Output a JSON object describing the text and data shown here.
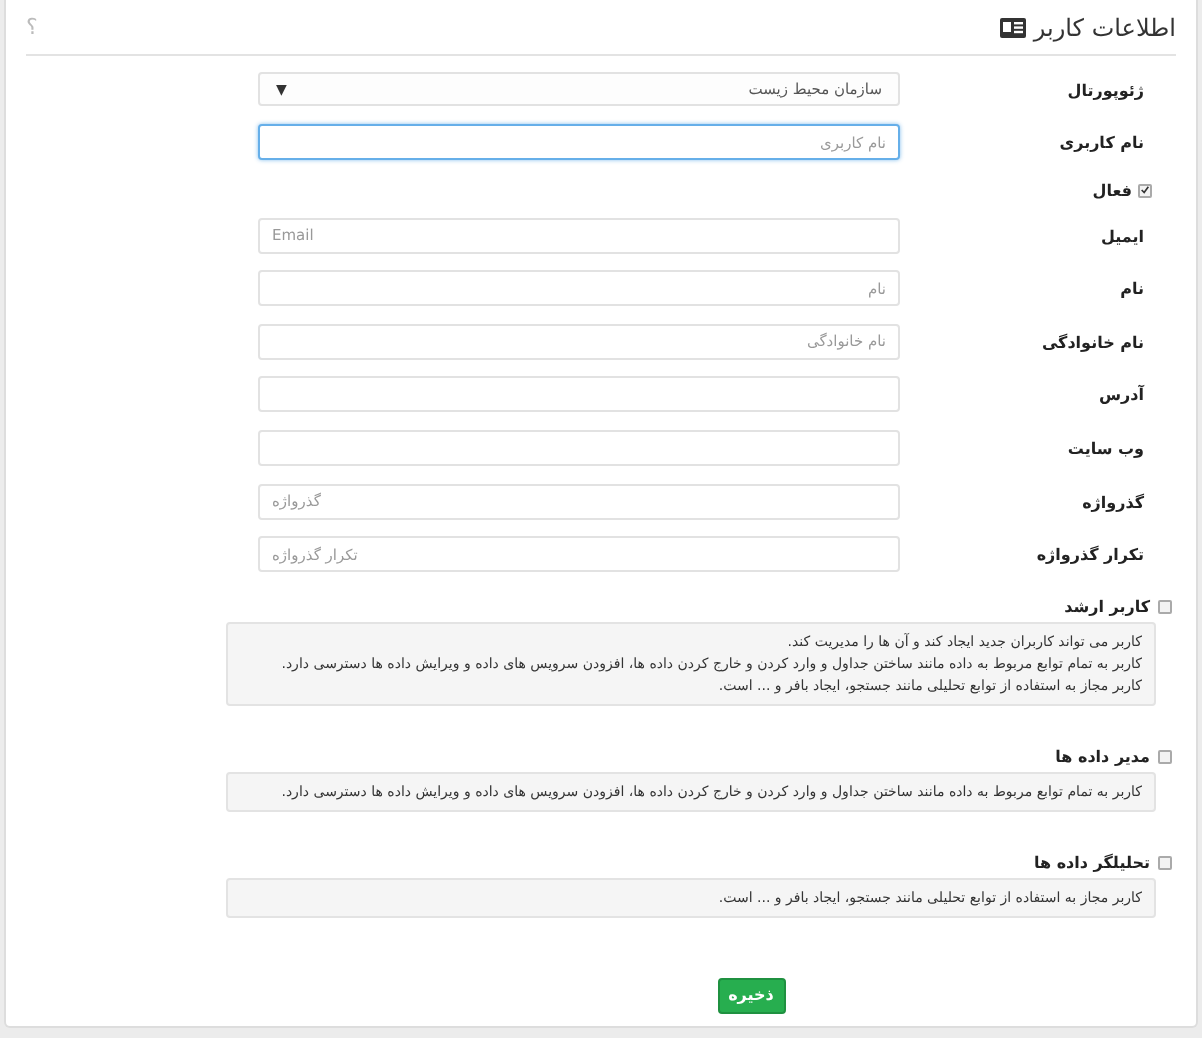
{
  "panel": {
    "title": "اطلاعات کاربر",
    "help": "؟"
  },
  "fields": [
    {
      "kind": "select",
      "label": "ژئوپورتال",
      "value": "سازمان محیط زیست",
      "caret": "▼"
    },
    {
      "kind": "input",
      "label": "نام کاربری",
      "placeholder": "نام کاربری",
      "focused": true
    },
    {
      "kind": "checkbox",
      "label": "فعال",
      "checked": true
    },
    {
      "kind": "input",
      "label": "ایمیل",
      "placeholder": "Email",
      "focused": false,
      "left_aligned": true
    },
    {
      "kind": "input",
      "label": "نام",
      "placeholder": "نام",
      "focused": false
    },
    {
      "kind": "input",
      "label": "نام خانوادگی",
      "placeholder": "نام خانوادگی",
      "focused": false
    },
    {
      "kind": "input",
      "label": "آدرس",
      "focused": false
    },
    {
      "kind": "input",
      "label": "وب سایت",
      "focused": false
    },
    {
      "kind": "input",
      "label": "گذرواژه",
      "placeholder": "گذرواژه",
      "focused": false,
      "left_aligned": true
    },
    {
      "kind": "input",
      "label": "تکرار گذرواژه",
      "placeholder": "تکرار گذرواژه",
      "focused": false,
      "left_aligned": true
    }
  ],
  "roles": [
    {
      "label": "کاربر ارشد",
      "checked": false,
      "lines": [
        "کاربر می تواند کاربران جدید ایجاد کند و آن ها را مدیریت کند.",
        "کاربر به تمام توابع مربوط به داده مانند ساختن جداول و وارد کردن و خارج کردن داده ها، افزودن سرویس های داده و ویرایش داده ها دسترسی دارد.",
        "کاربر مجاز به استفاده از توابع تحلیلی مانند جستجو، ایجاد بافر و ... است."
      ]
    },
    {
      "label": "مدیر داده ها",
      "checked": false,
      "lines": [
        "کاربر به تمام توابع مربوط به داده مانند ساختن جداول و وارد کردن و خارج کردن داده ها، افزودن سرویس های داده و ویرایش داده ها دسترسی دارد."
      ]
    },
    {
      "label": "تحلیلگر داده ها",
      "checked": false,
      "lines": [
        "کاربر مجاز به استفاده از توابع تحلیلی مانند جستجو، ایجاد بافر و ... است."
      ]
    }
  ],
  "save_button": "ذخیره"
}
